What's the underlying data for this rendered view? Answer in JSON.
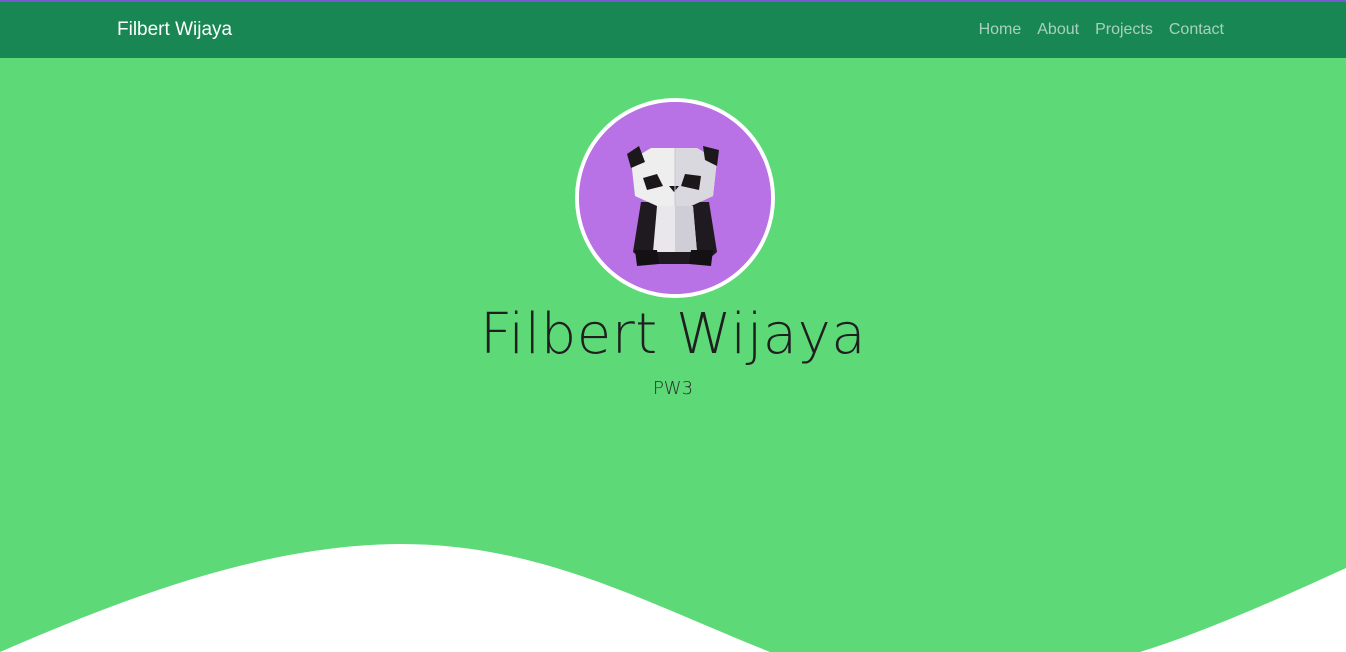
{
  "navbar": {
    "brand": "Filbert Wijaya",
    "links": [
      {
        "label": "Home"
      },
      {
        "label": "About"
      },
      {
        "label": "Projects"
      },
      {
        "label": "Contact"
      }
    ]
  },
  "hero": {
    "avatar_icon": "panda-image",
    "name": "Filbert Wijaya",
    "subtitle": "PW3"
  },
  "colors": {
    "navbar_bg": "#198754",
    "hero_bg": "#5dd977",
    "avatar_bg": "#b872e6",
    "wave": "#ffffff"
  }
}
